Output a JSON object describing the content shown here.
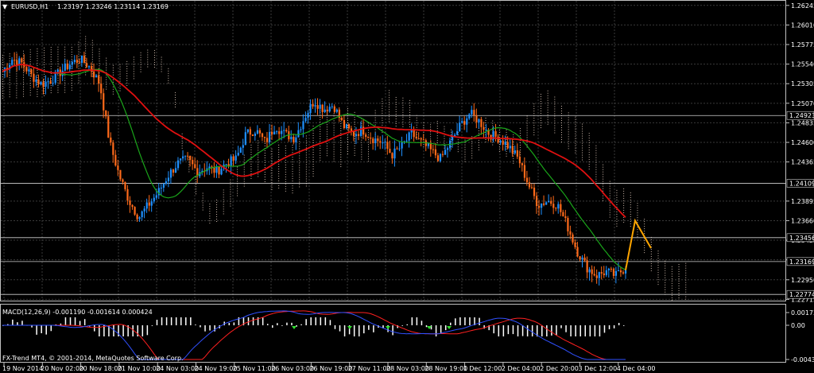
{
  "header": {
    "menu_glyph": "▼",
    "symbol_tf": "EURUSD,H1",
    "ohlc": "1.23197 1.23246 1.23114 1.23169"
  },
  "indicator": {
    "macd_label": "MACD(12,26,9) -0.001190 -0.001614 0.000424"
  },
  "footer": {
    "copyright": "FX-Trend MT4, © 2001-2014, MetaQuotes Software Corp."
  },
  "colors": {
    "bull": "#1e90ff",
    "bear": "#ff6a1a",
    "ma_slow": "#e01010",
    "ma_fast": "#1aa51a",
    "cloud": "#f0d8c8",
    "macd_main": "#3050ff",
    "macd_signal": "#ff2020",
    "histogram": "#ffffff",
    "projection": "#ffa500"
  },
  "chart_data": {
    "type": "candlestick",
    "symbol": "EURUSD",
    "timeframe": "H1",
    "y_ticks": [
      "1.26245",
      "1.26010",
      "1.25775",
      "1.25540",
      "1.25305",
      "1.25070",
      "1.24835",
      "1.24600",
      "1.24365",
      "1.23895",
      "1.23660",
      "1.23425",
      "1.23190",
      "1.22950",
      "1.22715"
    ],
    "price_marks": [
      "1.24923",
      "1.24109",
      "1.23456",
      "1.23169",
      "1.22774"
    ],
    "x_ticks": [
      "19 Nov 2014",
      "20 Nov 02:00",
      "20 Nov 18:00",
      "21 Nov 10:00",
      "24 Nov 03:00",
      "24 Nov 19:00",
      "25 Nov 11:00",
      "26 Nov 03:00",
      "26 Nov 19:00",
      "27 Nov 11:00",
      "28 Nov 03:00",
      "28 Nov 19:00",
      "1 Dec 12:00",
      "2 Dec 04:00",
      "2 Dec 20:00",
      "3 Dec 12:00",
      "4 Dec 04:00"
    ],
    "price_path": [
      1.2545,
      1.256,
      1.2555,
      1.254,
      1.253,
      1.2535,
      1.2545,
      1.2555,
      1.256,
      1.255,
      1.253,
      1.246,
      1.242,
      1.239,
      1.237,
      1.2385,
      1.24,
      1.242,
      1.2435,
      1.244,
      1.2425,
      1.243,
      1.2425,
      1.2435,
      1.244,
      1.247,
      1.2475,
      1.246,
      1.248,
      1.247,
      1.2465,
      1.249,
      1.251,
      1.25,
      1.2505,
      1.248,
      1.247,
      1.2475,
      1.2465,
      1.246,
      1.2445,
      1.2455,
      1.247,
      1.246,
      1.245,
      1.244,
      1.246,
      1.248,
      1.2495,
      1.2485,
      1.247,
      1.2465,
      1.2455,
      1.244,
      1.241,
      1.2385,
      1.239,
      1.2385,
      1.236,
      1.233,
      1.231,
      1.23,
      1.2305,
      1.23,
      1.231
    ],
    "macd_axis_ticks": [
      "0.00173",
      "0.00",
      "-0.00434"
    ]
  }
}
